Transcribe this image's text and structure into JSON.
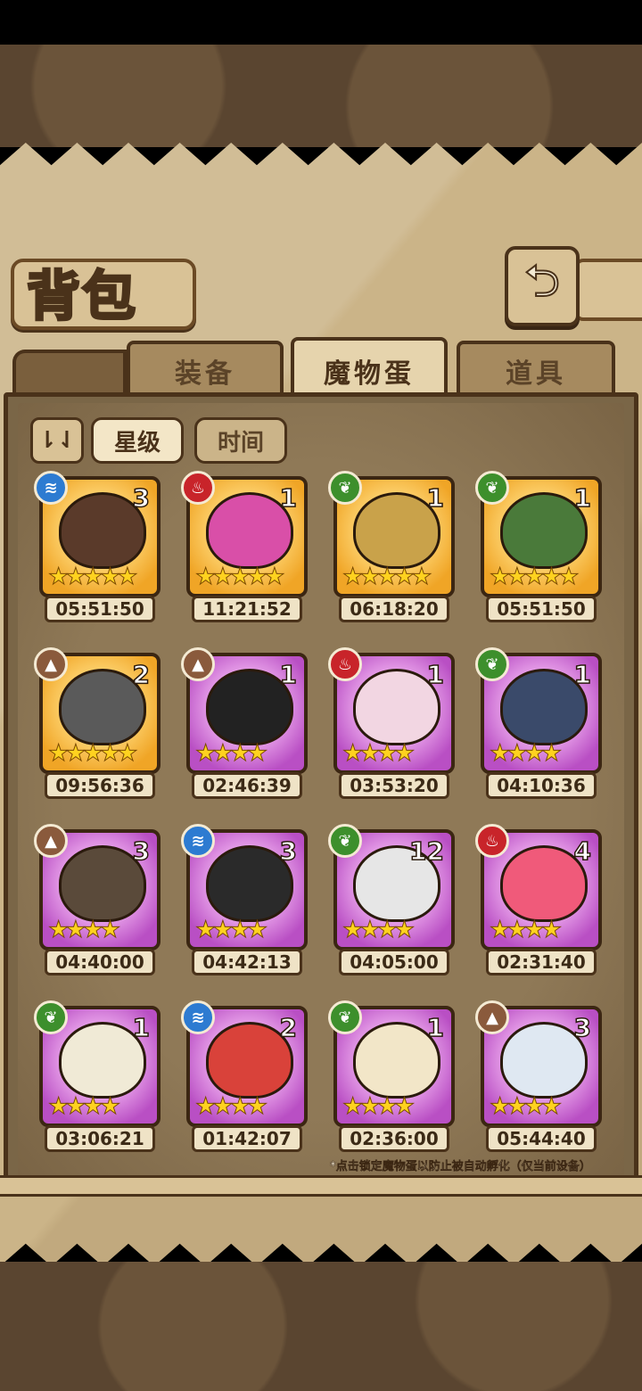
{
  "header": {
    "title": "背包",
    "back_icon": "back-arrow-icon"
  },
  "tabs": [
    {
      "label": "装备",
      "active": false
    },
    {
      "label": "魔物蛋",
      "active": true
    },
    {
      "label": "道具",
      "active": false
    }
  ],
  "sort": {
    "toggle_label": "⇂⇃",
    "buttons": [
      {
        "label": "星级",
        "active": true
      },
      {
        "label": "时间",
        "active": false
      }
    ]
  },
  "element_colors": {
    "water": "#2d7bd1",
    "fire": "#c8242a",
    "nature": "#3d8f2c",
    "earth": "#8a5a3c"
  },
  "eggs": [
    {
      "element": "water",
      "count": "3",
      "stars": 5,
      "frame": "gold",
      "timer": "05:51:50",
      "monster_color": "#5a3a2a"
    },
    {
      "element": "fire",
      "count": "1",
      "stars": 5,
      "frame": "gold",
      "timer": "11:21:52",
      "monster_color": "#d94fa8"
    },
    {
      "element": "nature",
      "count": "1",
      "stars": 5,
      "frame": "gold",
      "timer": "06:18:20",
      "monster_color": "#c9a24a"
    },
    {
      "element": "nature",
      "count": "1",
      "stars": 5,
      "frame": "gold",
      "timer": "05:51:50",
      "monster_color": "#4a7a3a"
    },
    {
      "element": "earth",
      "count": "2",
      "stars": 5,
      "frame": "gold",
      "timer": "09:56:36",
      "monster_color": "#5a5a5a"
    },
    {
      "element": "earth",
      "count": "1",
      "stars": 4,
      "frame": "purple",
      "timer": "02:46:39",
      "monster_color": "#222222"
    },
    {
      "element": "fire",
      "count": "1",
      "stars": 4,
      "frame": "purple",
      "timer": "03:53:20",
      "monster_color": "#f2d6e2"
    },
    {
      "element": "nature",
      "count": "1",
      "stars": 4,
      "frame": "purple",
      "timer": "04:10:36",
      "monster_color": "#3a4a6a"
    },
    {
      "element": "earth",
      "count": "3",
      "stars": 4,
      "frame": "purple",
      "timer": "04:40:00",
      "monster_color": "#5a4a3a"
    },
    {
      "element": "water",
      "count": "3",
      "stars": 4,
      "frame": "purple",
      "timer": "04:42:13",
      "monster_color": "#2a2a2a"
    },
    {
      "element": "nature",
      "count": "12",
      "stars": 4,
      "frame": "purple",
      "timer": "04:05:00",
      "monster_color": "#e6e6e6"
    },
    {
      "element": "fire",
      "count": "4",
      "stars": 4,
      "frame": "purple",
      "timer": "02:31:40",
      "monster_color": "#f05a7a"
    },
    {
      "element": "nature",
      "count": "1",
      "stars": 4,
      "frame": "purple",
      "timer": "03:06:21",
      "monster_color": "#f0ead6"
    },
    {
      "element": "water",
      "count": "2",
      "stars": 4,
      "frame": "purple",
      "timer": "01:42:07",
      "monster_color": "#d9423a"
    },
    {
      "element": "nature",
      "count": "1",
      "stars": 4,
      "frame": "purple",
      "timer": "02:36:00",
      "monster_color": "#f2e6c8"
    },
    {
      "element": "earth",
      "count": "3",
      "stars": 4,
      "frame": "purple",
      "timer": "05:44:40",
      "monster_color": "#dfe8f2"
    }
  ],
  "footnote": "*点击锁定魔物蛋以防止被自动孵化（仅当前设备）"
}
